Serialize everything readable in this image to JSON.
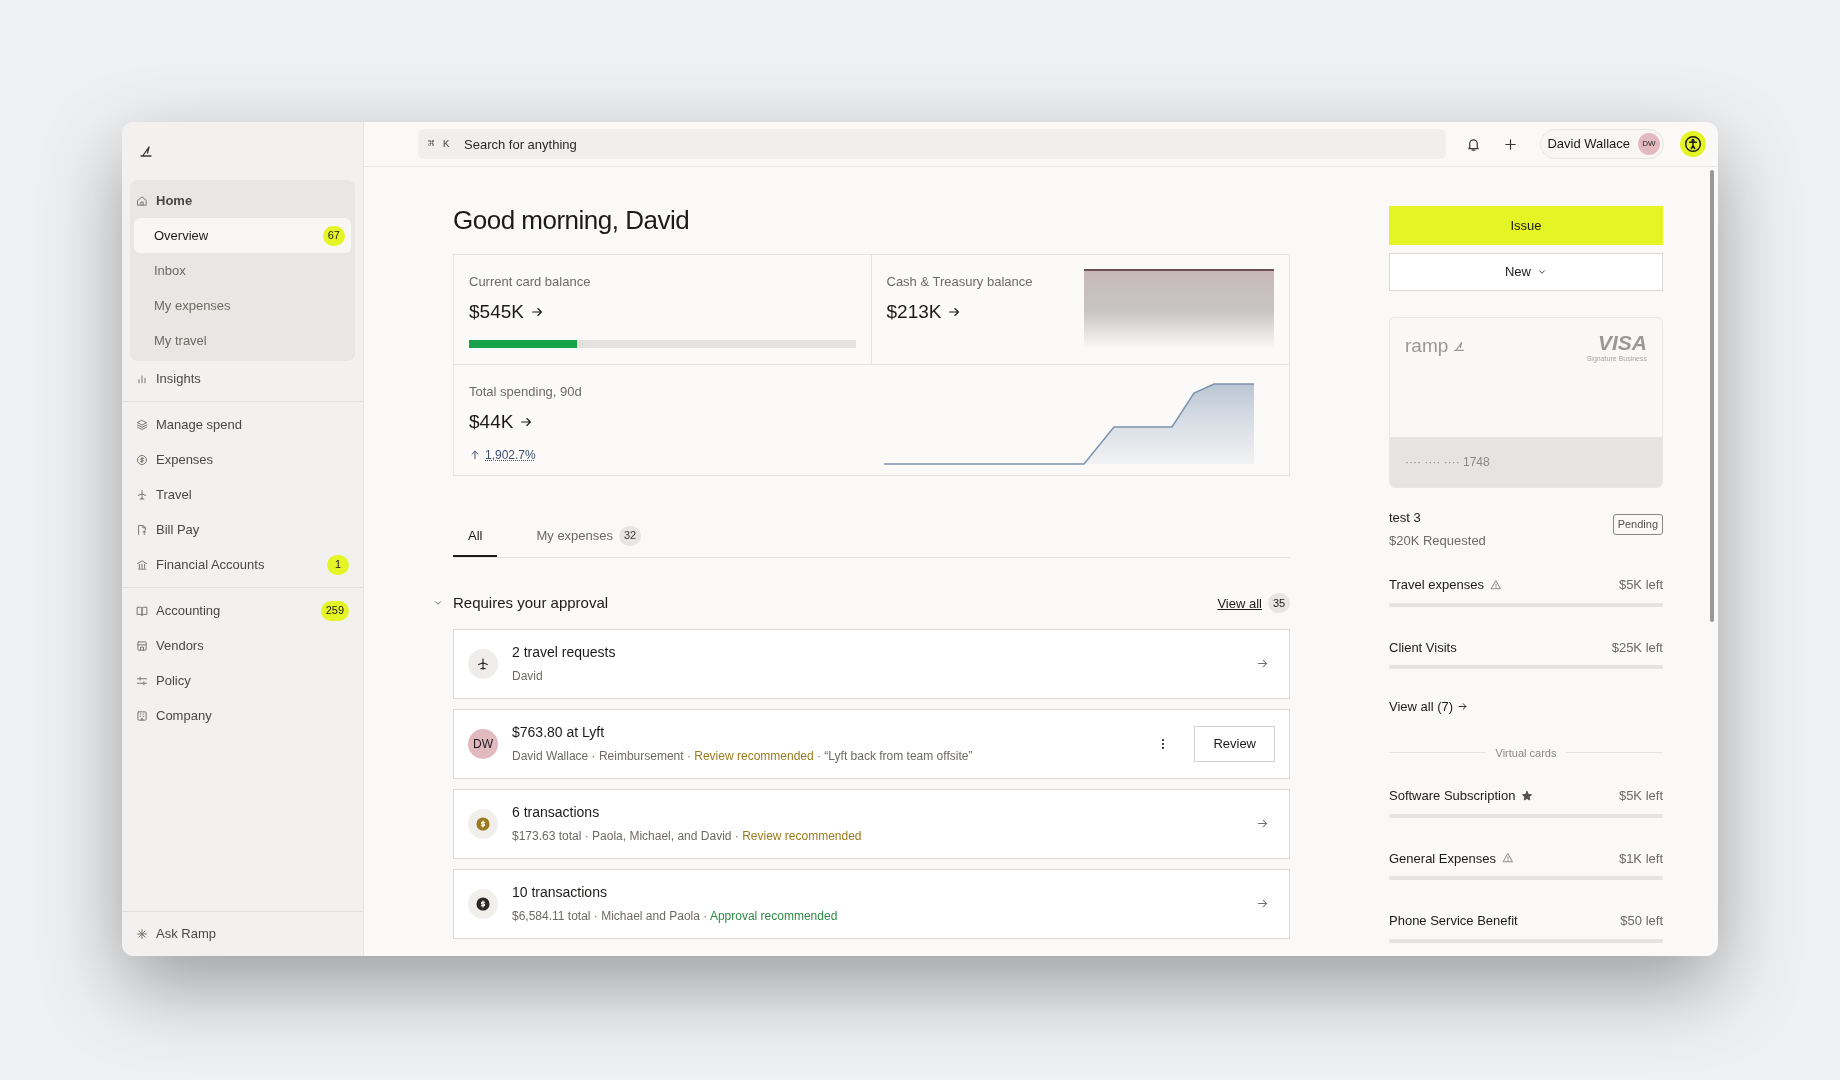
{
  "sidebar": {
    "sections": [
      [
        {
          "label": "Home",
          "expanded": true,
          "children": [
            {
              "label": "Overview",
              "selected": true,
              "badge": "67"
            },
            {
              "label": "Inbox",
              "selected": false
            },
            {
              "label": "My expenses",
              "selected": false
            },
            {
              "label": "My travel",
              "selected": false
            }
          ]
        },
        {
          "label": "Insights"
        }
      ],
      [
        {
          "label": "Manage spend"
        },
        {
          "label": "Expenses"
        },
        {
          "label": "Travel"
        },
        {
          "label": "Bill Pay"
        },
        {
          "label": "Financial Accounts",
          "badge": "1"
        }
      ],
      [
        {
          "label": "Accounting",
          "badge": "259"
        },
        {
          "label": "Vendors"
        },
        {
          "label": "Policy"
        },
        {
          "label": "Company"
        }
      ]
    ],
    "footer": "Ask Ramp"
  },
  "topbar": {
    "shortcut": [
      "⌘",
      "K"
    ],
    "search": {
      "placeholder": "Search for anything"
    },
    "user": {
      "name": "David Wallace",
      "initials": "DW"
    }
  },
  "greeting": "Good morning, David",
  "balances": {
    "card": {
      "label": "Current card balance",
      "value": "$545K",
      "level": 0.28
    },
    "cash": {
      "label": "Cash & Treasury balance",
      "value": "$213K"
    },
    "spending": {
      "label": "Total spending, 90d",
      "value": "$44K",
      "change": "1,902.7%"
    }
  },
  "tabs": [
    {
      "label": "All",
      "selected": true
    },
    {
      "label": "My expenses",
      "count": "32",
      "selected": false
    }
  ],
  "approval": {
    "title": "Requires your approval",
    "expanded": true,
    "view_all": "View all",
    "count": "35",
    "items": [
      {
        "kind": "travel",
        "title": "2 travel requests",
        "segments": [
          {
            "text": "David",
            "kind": "plain"
          }
        ]
      },
      {
        "kind": "expense",
        "initials": "DW",
        "title": "$763.80 at Lyft",
        "segments": [
          {
            "text": "David Wallace · Reimbursement · ",
            "kind": "plain"
          },
          {
            "text": "Review recommended",
            "kind": "review"
          },
          {
            "text": " · “Lyft back from team offsite”",
            "kind": "plain"
          }
        ],
        "action": "Review"
      },
      {
        "kind": "transactions",
        "title": "6 transactions",
        "segments": [
          {
            "text": "$173.63 total · Paola, Michael, and David · ",
            "kind": "plain"
          },
          {
            "text": "Review recommended",
            "kind": "review"
          }
        ],
        "color": "#9a7a1c"
      },
      {
        "kind": "transactions",
        "title": "10 transactions",
        "segments": [
          {
            "text": "$6,584.11 total · Michael and Paola · ",
            "kind": "plain"
          },
          {
            "text": "Approval recommended",
            "kind": "approval"
          }
        ],
        "color": "#2b2927"
      }
    ]
  },
  "actions": {
    "issue": "Issue",
    "new": "New"
  },
  "card": {
    "brand": "ramp",
    "network": "VISA",
    "tier": "Signature Business",
    "number": "···· ···· ···· 1748"
  },
  "request": {
    "title": "test 3",
    "subtitle": "$20K Requested",
    "status": "Pending"
  },
  "budgets": [
    {
      "name": "Travel expenses",
      "kind": "warning",
      "left": "$5K left"
    },
    {
      "name": "Client Visits",
      "kind": "plain",
      "left": "$25K left"
    }
  ],
  "budgets_link": "View all (7)",
  "virtual_label": "Virtual cards",
  "virtual_cards": [
    {
      "name": "Software Subscription",
      "kind": "starred",
      "left": "$5K left"
    },
    {
      "name": "General Expenses",
      "kind": "warning",
      "left": "$1K left"
    },
    {
      "name": "Phone Service Benefit",
      "kind": "plain",
      "left": "$50 left"
    }
  ]
}
